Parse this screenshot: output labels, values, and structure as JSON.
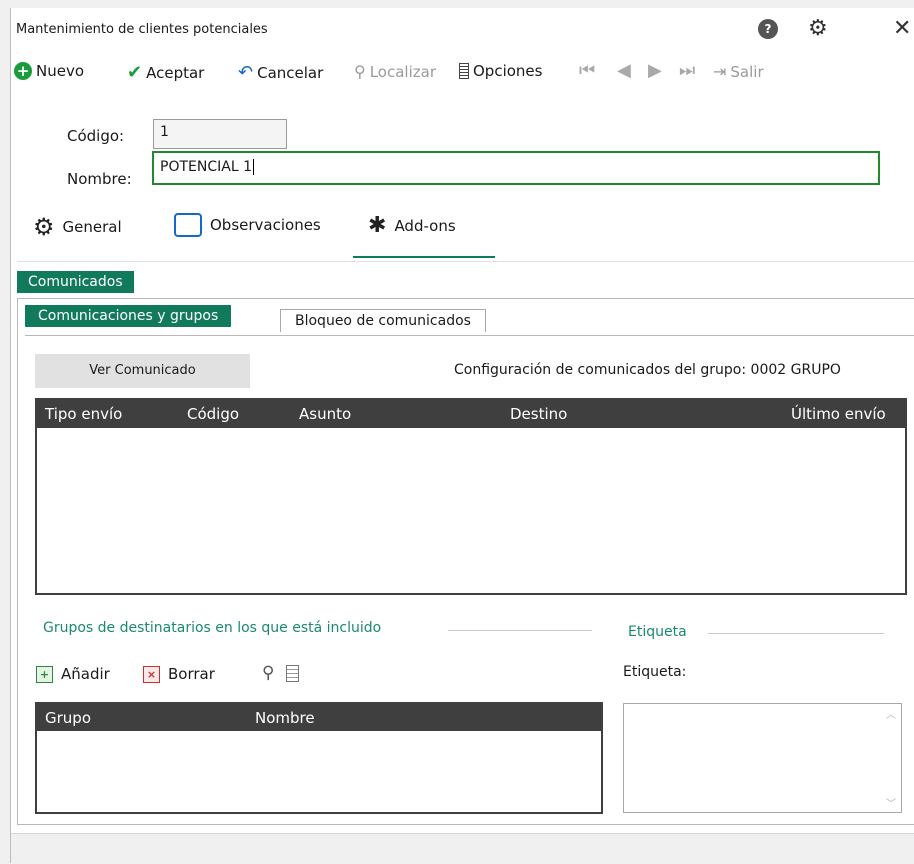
{
  "window": {
    "title": "Mantenimiento de clientes potenciales"
  },
  "toolbar": {
    "nuevo": "Nuevo",
    "aceptar": "Aceptar",
    "cancelar": "Cancelar",
    "localizar": "Localizar",
    "opciones": "Opciones",
    "salir": "Salir"
  },
  "form": {
    "codigo_label": "Código:",
    "codigo_value": "1",
    "nombre_label": "Nombre:",
    "nombre_value": "POTENCIAL 1"
  },
  "tabs": [
    {
      "label": "General"
    },
    {
      "label": "Observaciones"
    },
    {
      "label": "Add-ons"
    }
  ],
  "subtabs": {
    "level1": "Comunicados",
    "level2": [
      "Comunicaciones y grupos",
      "Bloqueo de comunicados"
    ]
  },
  "comunicados": {
    "ver_button": "Ver Comunicado",
    "config_text": "Configuración de comunicados del grupo: 0002 GRUPO",
    "columns": [
      "Tipo envío",
      "Código",
      "Asunto",
      "Destino",
      "Último envío"
    ]
  },
  "grupos": {
    "section_title": "Grupos de destinatarios en los que está incluido",
    "add_label": "Añadir",
    "delete_label": "Borrar",
    "columns": [
      "Grupo",
      "Nombre"
    ]
  },
  "etiqueta": {
    "section_title": "Etiqueta",
    "label": "Etiqueta:"
  },
  "colors": {
    "accent": "#127a5c",
    "active_border": "#1f8a2e",
    "grid_header": "#3f3f3f"
  }
}
